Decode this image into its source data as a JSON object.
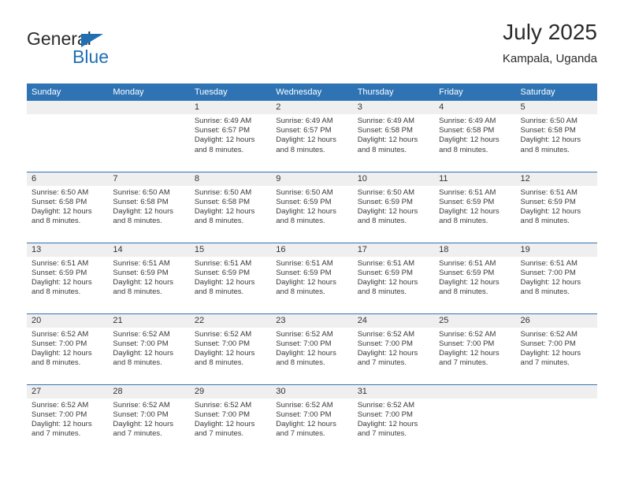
{
  "brand": {
    "name_top": "General",
    "name_bottom": "Blue",
    "accent_color": "#1f6fb2"
  },
  "header": {
    "title": "July 2025",
    "location": "Kampala, Uganda"
  },
  "theme": {
    "header_bar": "#2e74b5",
    "daynum_band": "#efefef",
    "text": "#3a3a3a"
  },
  "weekday_headers": [
    "Sunday",
    "Monday",
    "Tuesday",
    "Wednesday",
    "Thursday",
    "Friday",
    "Saturday"
  ],
  "labels": {
    "sunrise_prefix": "Sunrise:",
    "sunset_prefix": "Sunset:",
    "daylight_prefix": "Daylight:"
  },
  "weeks": [
    [
      {
        "day": "",
        "sunrise": "",
        "sunset": "",
        "daylight_line1": "",
        "daylight_line2": ""
      },
      {
        "day": "",
        "sunrise": "",
        "sunset": "",
        "daylight_line1": "",
        "daylight_line2": ""
      },
      {
        "day": "1",
        "sunrise": "Sunrise: 6:49 AM",
        "sunset": "Sunset: 6:57 PM",
        "daylight_line1": "Daylight: 12 hours",
        "daylight_line2": "and 8 minutes."
      },
      {
        "day": "2",
        "sunrise": "Sunrise: 6:49 AM",
        "sunset": "Sunset: 6:57 PM",
        "daylight_line1": "Daylight: 12 hours",
        "daylight_line2": "and 8 minutes."
      },
      {
        "day": "3",
        "sunrise": "Sunrise: 6:49 AM",
        "sunset": "Sunset: 6:58 PM",
        "daylight_line1": "Daylight: 12 hours",
        "daylight_line2": "and 8 minutes."
      },
      {
        "day": "4",
        "sunrise": "Sunrise: 6:49 AM",
        "sunset": "Sunset: 6:58 PM",
        "daylight_line1": "Daylight: 12 hours",
        "daylight_line2": "and 8 minutes."
      },
      {
        "day": "5",
        "sunrise": "Sunrise: 6:50 AM",
        "sunset": "Sunset: 6:58 PM",
        "daylight_line1": "Daylight: 12 hours",
        "daylight_line2": "and 8 minutes."
      }
    ],
    [
      {
        "day": "6",
        "sunrise": "Sunrise: 6:50 AM",
        "sunset": "Sunset: 6:58 PM",
        "daylight_line1": "Daylight: 12 hours",
        "daylight_line2": "and 8 minutes."
      },
      {
        "day": "7",
        "sunrise": "Sunrise: 6:50 AM",
        "sunset": "Sunset: 6:58 PM",
        "daylight_line1": "Daylight: 12 hours",
        "daylight_line2": "and 8 minutes."
      },
      {
        "day": "8",
        "sunrise": "Sunrise: 6:50 AM",
        "sunset": "Sunset: 6:58 PM",
        "daylight_line1": "Daylight: 12 hours",
        "daylight_line2": "and 8 minutes."
      },
      {
        "day": "9",
        "sunrise": "Sunrise: 6:50 AM",
        "sunset": "Sunset: 6:59 PM",
        "daylight_line1": "Daylight: 12 hours",
        "daylight_line2": "and 8 minutes."
      },
      {
        "day": "10",
        "sunrise": "Sunrise: 6:50 AM",
        "sunset": "Sunset: 6:59 PM",
        "daylight_line1": "Daylight: 12 hours",
        "daylight_line2": "and 8 minutes."
      },
      {
        "day": "11",
        "sunrise": "Sunrise: 6:51 AM",
        "sunset": "Sunset: 6:59 PM",
        "daylight_line1": "Daylight: 12 hours",
        "daylight_line2": "and 8 minutes."
      },
      {
        "day": "12",
        "sunrise": "Sunrise: 6:51 AM",
        "sunset": "Sunset: 6:59 PM",
        "daylight_line1": "Daylight: 12 hours",
        "daylight_line2": "and 8 minutes."
      }
    ],
    [
      {
        "day": "13",
        "sunrise": "Sunrise: 6:51 AM",
        "sunset": "Sunset: 6:59 PM",
        "daylight_line1": "Daylight: 12 hours",
        "daylight_line2": "and 8 minutes."
      },
      {
        "day": "14",
        "sunrise": "Sunrise: 6:51 AM",
        "sunset": "Sunset: 6:59 PM",
        "daylight_line1": "Daylight: 12 hours",
        "daylight_line2": "and 8 minutes."
      },
      {
        "day": "15",
        "sunrise": "Sunrise: 6:51 AM",
        "sunset": "Sunset: 6:59 PM",
        "daylight_line1": "Daylight: 12 hours",
        "daylight_line2": "and 8 minutes."
      },
      {
        "day": "16",
        "sunrise": "Sunrise: 6:51 AM",
        "sunset": "Sunset: 6:59 PM",
        "daylight_line1": "Daylight: 12 hours",
        "daylight_line2": "and 8 minutes."
      },
      {
        "day": "17",
        "sunrise": "Sunrise: 6:51 AM",
        "sunset": "Sunset: 6:59 PM",
        "daylight_line1": "Daylight: 12 hours",
        "daylight_line2": "and 8 minutes."
      },
      {
        "day": "18",
        "sunrise": "Sunrise: 6:51 AM",
        "sunset": "Sunset: 6:59 PM",
        "daylight_line1": "Daylight: 12 hours",
        "daylight_line2": "and 8 minutes."
      },
      {
        "day": "19",
        "sunrise": "Sunrise: 6:51 AM",
        "sunset": "Sunset: 7:00 PM",
        "daylight_line1": "Daylight: 12 hours",
        "daylight_line2": "and 8 minutes."
      }
    ],
    [
      {
        "day": "20",
        "sunrise": "Sunrise: 6:52 AM",
        "sunset": "Sunset: 7:00 PM",
        "daylight_line1": "Daylight: 12 hours",
        "daylight_line2": "and 8 minutes."
      },
      {
        "day": "21",
        "sunrise": "Sunrise: 6:52 AM",
        "sunset": "Sunset: 7:00 PM",
        "daylight_line1": "Daylight: 12 hours",
        "daylight_line2": "and 8 minutes."
      },
      {
        "day": "22",
        "sunrise": "Sunrise: 6:52 AM",
        "sunset": "Sunset: 7:00 PM",
        "daylight_line1": "Daylight: 12 hours",
        "daylight_line2": "and 8 minutes."
      },
      {
        "day": "23",
        "sunrise": "Sunrise: 6:52 AM",
        "sunset": "Sunset: 7:00 PM",
        "daylight_line1": "Daylight: 12 hours",
        "daylight_line2": "and 8 minutes."
      },
      {
        "day": "24",
        "sunrise": "Sunrise: 6:52 AM",
        "sunset": "Sunset: 7:00 PM",
        "daylight_line1": "Daylight: 12 hours",
        "daylight_line2": "and 7 minutes."
      },
      {
        "day": "25",
        "sunrise": "Sunrise: 6:52 AM",
        "sunset": "Sunset: 7:00 PM",
        "daylight_line1": "Daylight: 12 hours",
        "daylight_line2": "and 7 minutes."
      },
      {
        "day": "26",
        "sunrise": "Sunrise: 6:52 AM",
        "sunset": "Sunset: 7:00 PM",
        "daylight_line1": "Daylight: 12 hours",
        "daylight_line2": "and 7 minutes."
      }
    ],
    [
      {
        "day": "27",
        "sunrise": "Sunrise: 6:52 AM",
        "sunset": "Sunset: 7:00 PM",
        "daylight_line1": "Daylight: 12 hours",
        "daylight_line2": "and 7 minutes."
      },
      {
        "day": "28",
        "sunrise": "Sunrise: 6:52 AM",
        "sunset": "Sunset: 7:00 PM",
        "daylight_line1": "Daylight: 12 hours",
        "daylight_line2": "and 7 minutes."
      },
      {
        "day": "29",
        "sunrise": "Sunrise: 6:52 AM",
        "sunset": "Sunset: 7:00 PM",
        "daylight_line1": "Daylight: 12 hours",
        "daylight_line2": "and 7 minutes."
      },
      {
        "day": "30",
        "sunrise": "Sunrise: 6:52 AM",
        "sunset": "Sunset: 7:00 PM",
        "daylight_line1": "Daylight: 12 hours",
        "daylight_line2": "and 7 minutes."
      },
      {
        "day": "31",
        "sunrise": "Sunrise: 6:52 AM",
        "sunset": "Sunset: 7:00 PM",
        "daylight_line1": "Daylight: 12 hours",
        "daylight_line2": "and 7 minutes."
      },
      {
        "day": "",
        "sunrise": "",
        "sunset": "",
        "daylight_line1": "",
        "daylight_line2": ""
      },
      {
        "day": "",
        "sunrise": "",
        "sunset": "",
        "daylight_line1": "",
        "daylight_line2": ""
      }
    ]
  ]
}
